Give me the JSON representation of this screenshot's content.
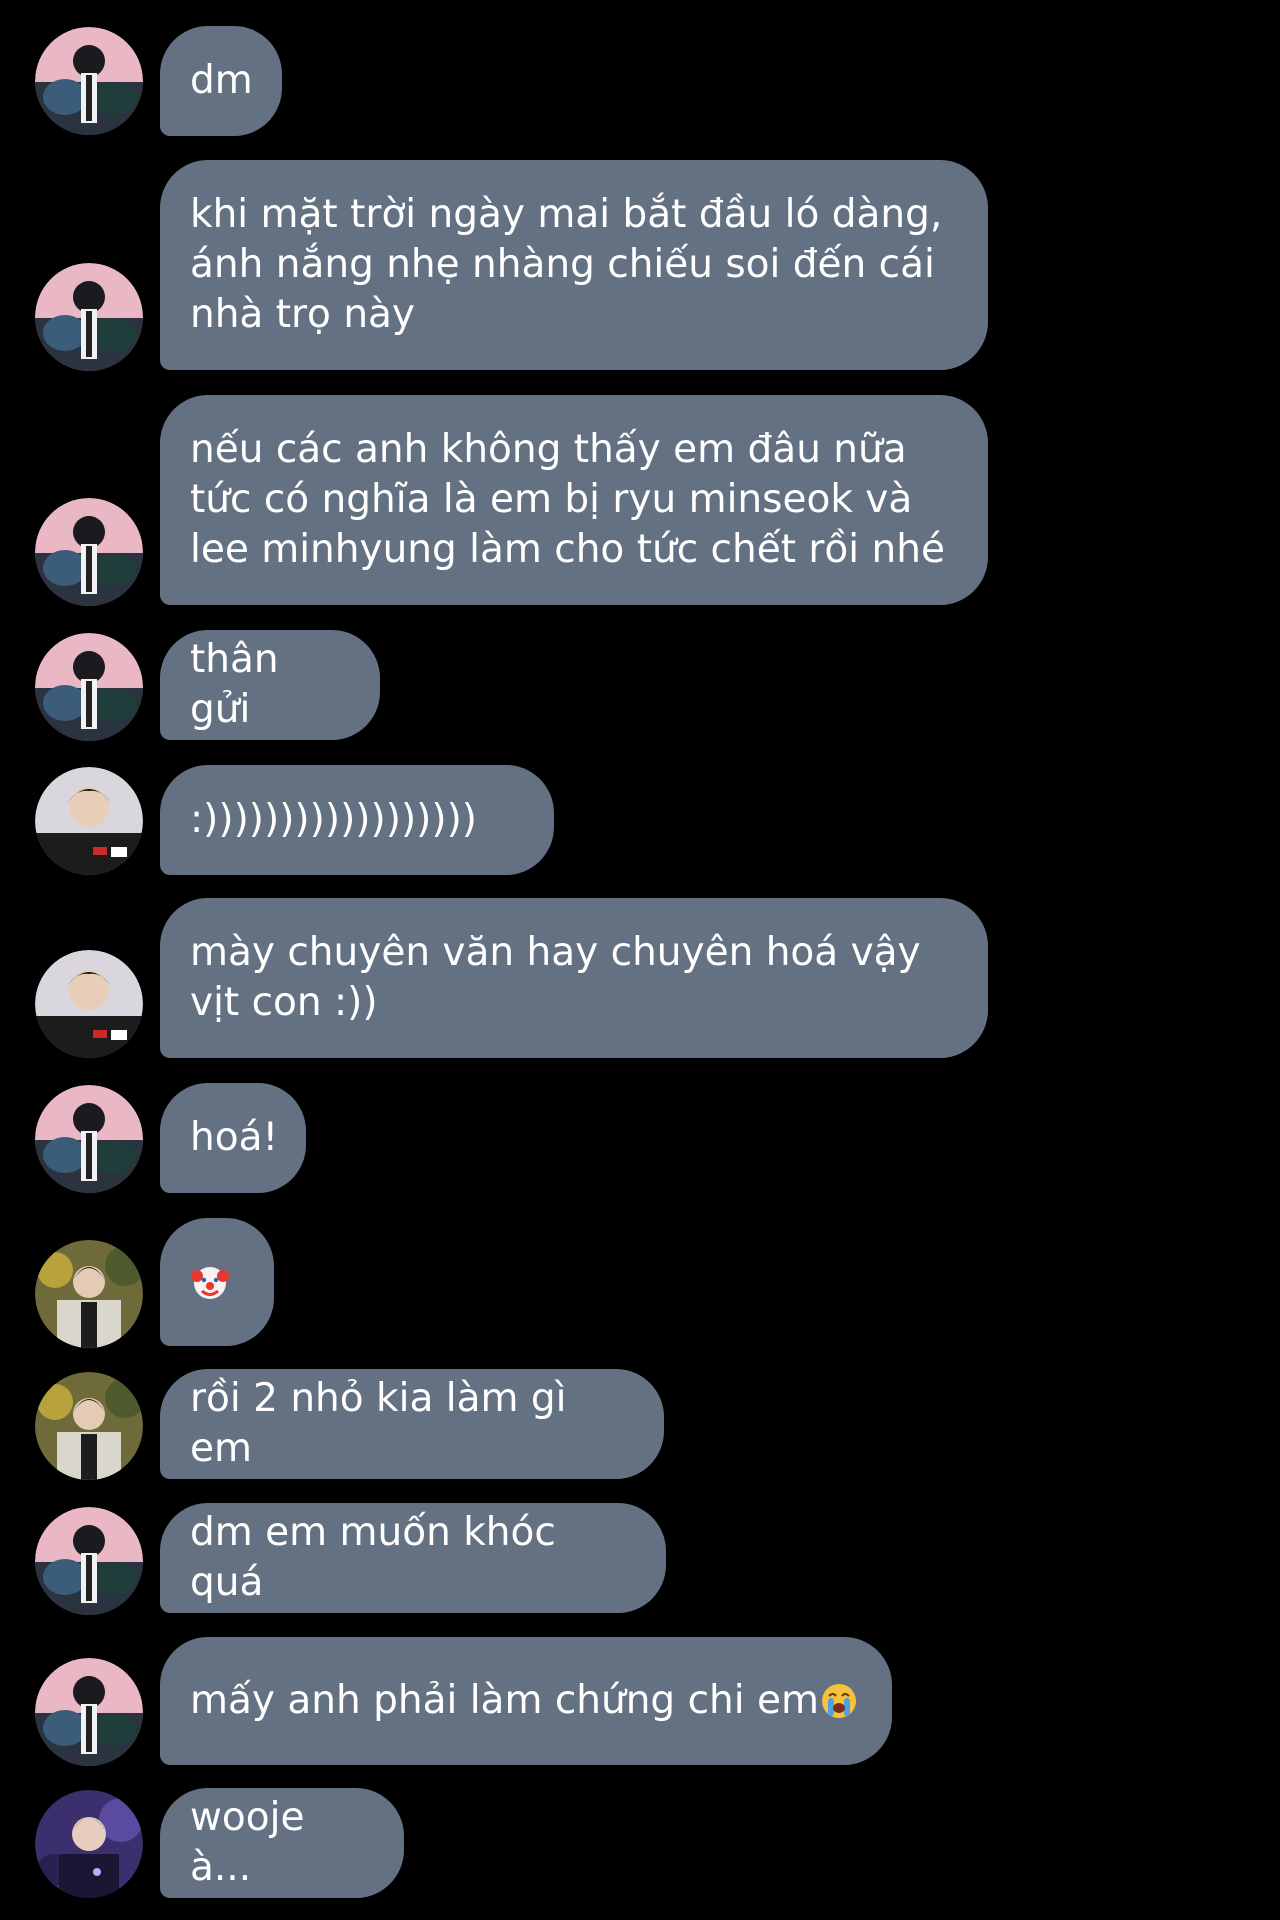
{
  "colors": {
    "background": "#000000",
    "bubble": "#637182",
    "text": "#ffffff"
  },
  "messages": [
    {
      "sender": "avatar-a",
      "text": "dm"
    },
    {
      "sender": "avatar-a",
      "text": "khi mặt trời ngày mai bắt đầu ló dàng,\nánh nắng nhẹ nhàng chiếu soi đến cái\nnhà trọ này"
    },
    {
      "sender": "avatar-a",
      "text": "nếu các anh không thấy em đâu nữa\ntức có nghĩa là em bị ryu minseok và\nlee minhyung làm cho tức chết rồi nhé"
    },
    {
      "sender": "avatar-a",
      "text": "thân gửi"
    },
    {
      "sender": "avatar-b",
      "text": ":))))))))))))))))))"
    },
    {
      "sender": "avatar-b",
      "text": "mày chuyên văn hay chuyên hoá vậy\nvịt con :))"
    },
    {
      "sender": "avatar-a",
      "text": "hoá!"
    },
    {
      "sender": "avatar-c",
      "text": "",
      "emoji": "clown-face-emoji"
    },
    {
      "sender": "avatar-c",
      "text": "rồi 2 nhỏ kia làm gì em"
    },
    {
      "sender": "avatar-a",
      "text": "dm em muốn khóc quá"
    },
    {
      "sender": "avatar-a",
      "text": "mấy anh phải làm chứng chi em",
      "emoji": "loudly-crying-face-emoji"
    },
    {
      "sender": "avatar-d",
      "text": "wooje à..."
    }
  ]
}
